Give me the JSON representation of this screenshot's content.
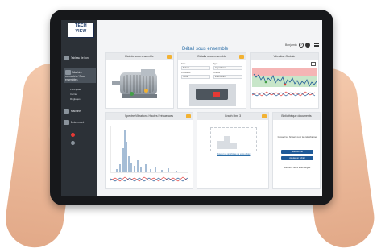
{
  "logo": {
    "line1": "TECH",
    "line2": "VIEW"
  },
  "sidebar": {
    "items": [
      {
        "label": "Tableau de bord"
      },
      {
        "label": "Machine connectée / Sous ensembles"
      },
      {
        "label": "Machine"
      },
      {
        "label": "Evènement"
      }
    ],
    "sub_items": [
      "Principale",
      "Carrier",
      "Réglages"
    ]
  },
  "header": {
    "title": "Détail sous ensemble",
    "user": "Benjamin"
  },
  "cards": {
    "state": {
      "title": "Etat du sous ensemble"
    },
    "details": {
      "title": "Détails sous ensemble",
      "fields": [
        {
          "label": "Nom",
          "value": "Moteur"
        },
        {
          "label": "Type",
          "value": "Asynchrone"
        },
        {
          "label": "Puissance",
          "value": "75 kW"
        },
        {
          "label": "Vitesse",
          "value": "1500 tr/min"
        }
      ]
    },
    "vibration": {
      "title": "Vibration Globale"
    },
    "spectrum": {
      "title": "Spectre Vibrations Hautes Fréquences"
    },
    "free_slot": {
      "title": "Graph libre 3",
      "link": "Ajouter un graphique de votre choix"
    },
    "docs": {
      "title": "Bibliothèque documents",
      "text": "Glissez les fichiers pour les télécharger",
      "button1": "Sélectionner",
      "button2": "Ajouter un fichier",
      "footer": "Derniers docs téléchargés"
    }
  },
  "colors": {
    "sidebar": "#2c3137",
    "accent": "#2b6ea8",
    "warning": "#f2b233",
    "alarm_zone": "#f5b5b5",
    "ok_zone": "#c8e6c9"
  }
}
